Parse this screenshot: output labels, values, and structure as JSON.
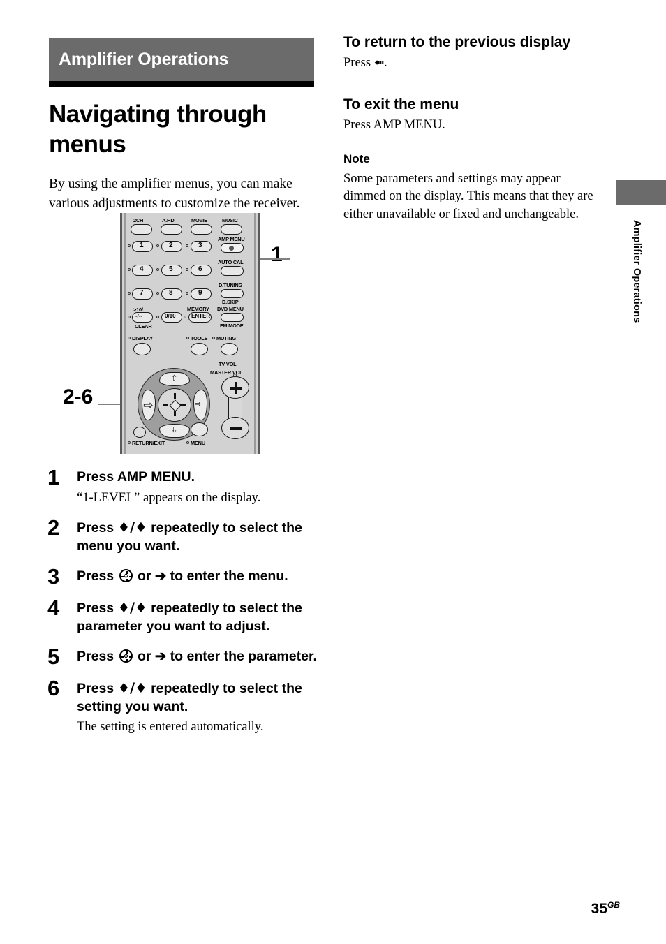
{
  "chapter": {
    "label": "Amplifier Operations"
  },
  "title": {
    "line1": "Navigating through",
    "line2": "menus"
  },
  "intro": "By using the amplifier menus, you can make various adjustments to customize the receiver.",
  "figure": {
    "callout_amp_menu": "1",
    "callout_dpad": "2-6",
    "remote_labels": {
      "two_ch": "2CH",
      "afd": "A.F.D.",
      "movie": "MOVIE",
      "music": "MUSIC",
      "amp_menu": "AMP MENU",
      "auto_cal": "AUTO CAL",
      "d_tuning": "D.TUNING",
      "d_skip": "D.SKIP",
      "dvd_menu": "DVD MENU",
      "fm_mode": "FM MODE",
      "memory": "MEMORY",
      "enter": "ENTER",
      "clear": "CLEAR",
      "ten_more": ">10/.",
      "dash": "-/--",
      "zero_ten": "0/10",
      "display": "DISPLAY",
      "tools": "TOOLS",
      "muting": "MUTING",
      "tv_vol": "TV VOL",
      "master_vol": "MASTER VOL",
      "return_exit": "RETURN/EXIT",
      "menu": "MENU",
      "num1": "1",
      "num2": "2",
      "num3": "3",
      "num4": "4",
      "num5": "5",
      "num6": "6",
      "num7": "7",
      "num8": "8",
      "num9": "9"
    }
  },
  "steps": [
    {
      "number": "1",
      "head": "Press AMP MENU.",
      "sub": "“1-LEVEL” appears on the display."
    },
    {
      "number": "2",
      "head_pre": "Press ",
      "head_arrows": "♦/♦",
      "head_post": " repeatedly to select the menu you want.",
      "sub": ""
    },
    {
      "number": "3",
      "head_pre": "Press ",
      "head_post": " or ➔ to enter the menu.",
      "sub": ""
    },
    {
      "number": "4",
      "head_pre": "Press ",
      "head_arrows": "♦/♦",
      "head_post": " repeatedly to select the parameter you want to adjust.",
      "sub": ""
    },
    {
      "number": "5",
      "head_pre": "Press ",
      "head_post": " or ➔ to enter the parameter.",
      "sub": ""
    },
    {
      "number": "6",
      "head_pre": "Press ",
      "head_arrows": "♦/♦",
      "head_post": " repeatedly to select the setting you want.",
      "sub": "The setting is entered automatically."
    }
  ],
  "right": {
    "return_head": "To return to the previous display",
    "return_body_pre": "Press ",
    "return_body_post": ".",
    "exit_head": "To exit the menu",
    "exit_body": "Press AMP MENU.",
    "note_head": "Note",
    "note_body": "Some parameters and settings may appear dimmed on the display. This means that they are either unavailable or fixed and unchangeable."
  },
  "side_tab": {
    "label": "Amplifier Operations"
  },
  "footer": {
    "page": "35",
    "region": "GB"
  },
  "colors": {
    "chapter_bar": "#6b6b6b",
    "rule": "#000000",
    "remote_body": "#d2d2d2"
  }
}
